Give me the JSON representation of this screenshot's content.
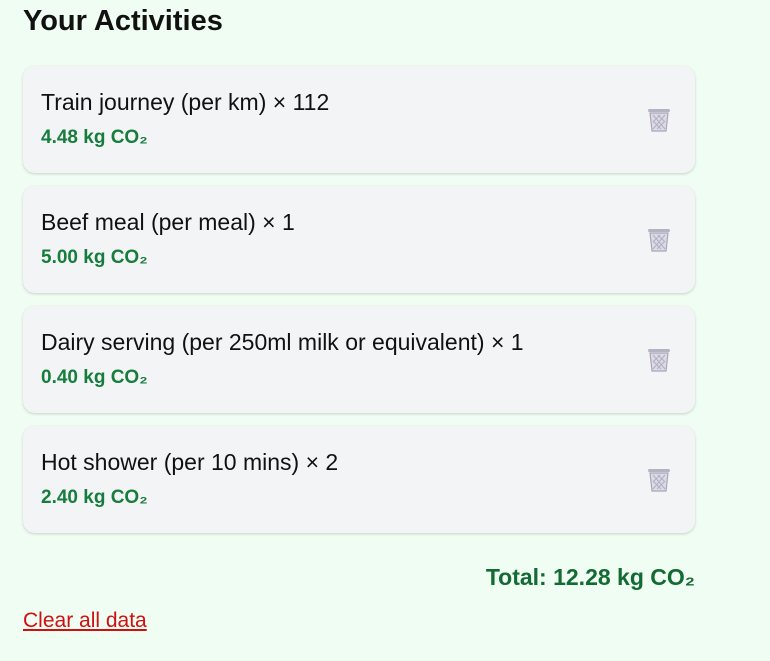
{
  "title": "Your Activities",
  "activities": [
    {
      "name": "Train journey (per km) × 112",
      "co2": "4.48 kg CO₂",
      "delete_icon": "trash-bin-icon"
    },
    {
      "name": "Beef meal (per meal) × 1",
      "co2": "5.00 kg CO₂",
      "delete_icon": "trash-bin-icon"
    },
    {
      "name": "Dairy serving (per 250ml milk or equivalent) × 1",
      "co2": "0.40 kg CO₂",
      "delete_icon": "trash-bin-icon"
    },
    {
      "name": "Hot shower (per 10 mins) × 2",
      "co2": "2.40 kg CO₂",
      "delete_icon": "trash-bin-icon"
    }
  ],
  "total": "Total: 12.28 kg CO₂",
  "clear_label": "Clear all data",
  "colors": {
    "background": "#effdf3",
    "card": "#f3f4f6",
    "co2_green": "#167d3c",
    "total_green": "#136a33",
    "clear_red": "#d01010"
  }
}
